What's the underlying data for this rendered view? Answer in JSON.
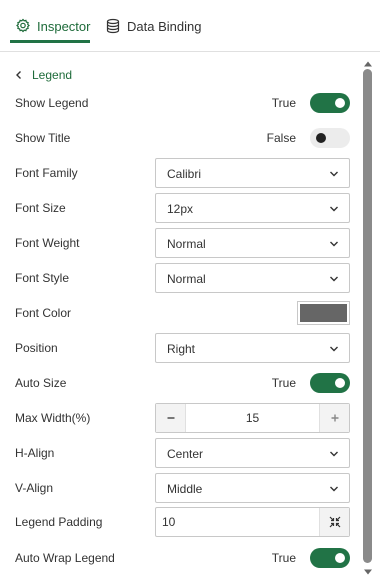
{
  "tabs": [
    {
      "label": "Inspector",
      "icon": "gear-icon",
      "active": true
    },
    {
      "label": "Data Binding",
      "icon": "database-icon",
      "active": false
    }
  ],
  "breadcrumb": {
    "label": "Legend"
  },
  "properties": {
    "show_legend": {
      "label": "Show Legend",
      "value": "True"
    },
    "show_title": {
      "label": "Show Title",
      "value": "False"
    },
    "font_family": {
      "label": "Font Family",
      "value": "Calibri"
    },
    "font_size": {
      "label": "Font Size",
      "value": "12px"
    },
    "font_weight": {
      "label": "Font Weight",
      "value": "Normal"
    },
    "font_style": {
      "label": "Font Style",
      "value": "Normal"
    },
    "font_color": {
      "label": "Font Color",
      "value": "#666666"
    },
    "position": {
      "label": "Position",
      "value": "Right"
    },
    "auto_size": {
      "label": "Auto Size",
      "value": "True"
    },
    "max_width": {
      "label": "Max Width(%)",
      "value": "15"
    },
    "h_align": {
      "label": "H-Align",
      "value": "Center"
    },
    "v_align": {
      "label": "V-Align",
      "value": "Middle"
    },
    "legend_padding": {
      "label": "Legend Padding",
      "value": "10"
    },
    "auto_wrap_legend": {
      "label": "Auto Wrap Legend",
      "value": "True"
    }
  },
  "colors": {
    "accent": "#217346",
    "toggle_off": "#ececec"
  }
}
